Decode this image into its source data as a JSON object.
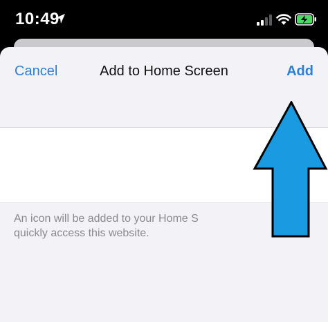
{
  "status_bar": {
    "time": "10:49",
    "icons": [
      "location-arrow-icon",
      "cellular-signal-icon",
      "wifi-icon",
      "battery-charging-icon"
    ],
    "battery_color": "#4cd964"
  },
  "sheet": {
    "cancel_label": "Cancel",
    "title": "Add to Home Screen",
    "add_label": "Add",
    "name_value": "",
    "footer_line1": "An icon will be added to your Home S",
    "footer_line2": "quickly access this website."
  },
  "overlay": {
    "arrow_color": "#1a9ae0",
    "arrow_stroke": "#000000"
  },
  "colors": {
    "accent": "#2f7ed8",
    "sheet_bg": "#f2f2f7",
    "card_bg": "#ffffff",
    "footer_text": "#8a8a8e"
  }
}
